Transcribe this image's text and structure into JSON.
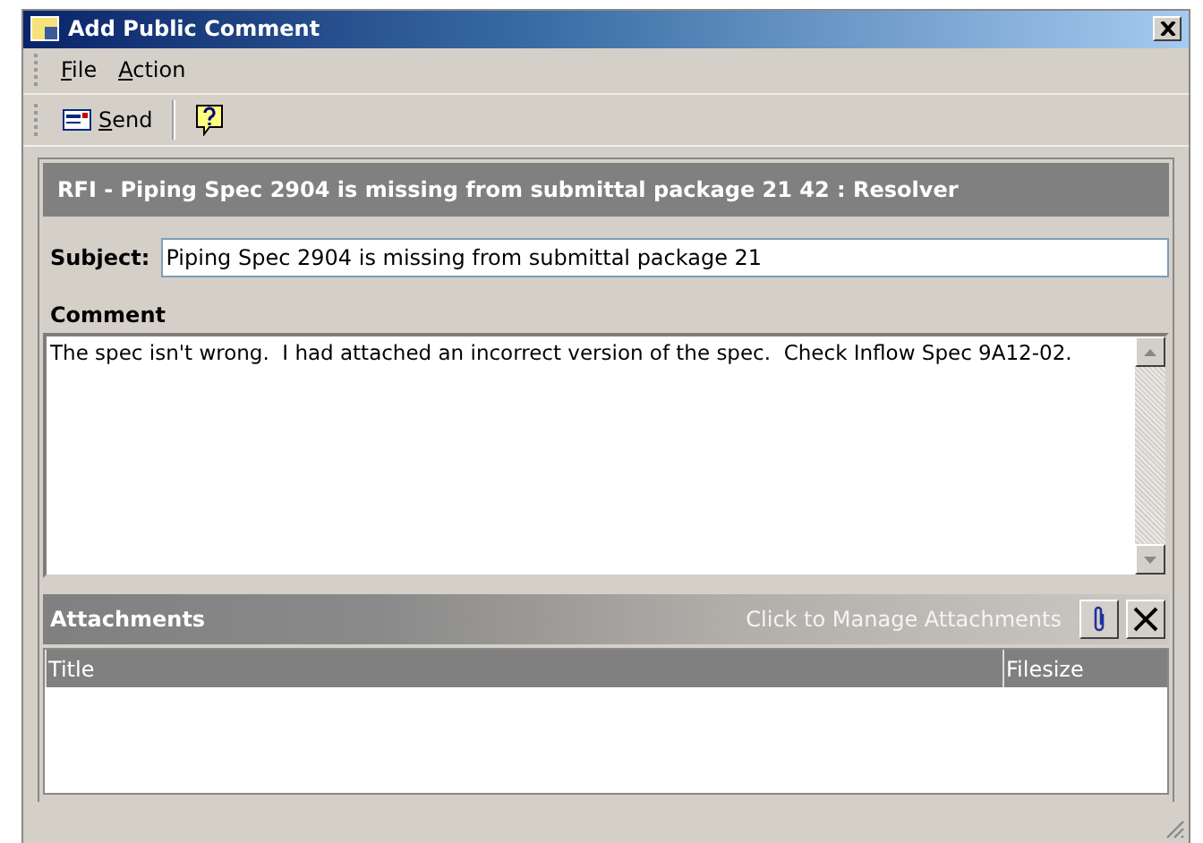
{
  "window": {
    "title": "Add Public Comment"
  },
  "menu": [
    {
      "label": "File"
    },
    {
      "label": "Action"
    }
  ],
  "toolbar": {
    "send": "Send"
  },
  "header": "RFI - Piping Spec 2904 is missing from submittal package 21 42 : Resolver",
  "subject": {
    "label": "Subject:",
    "value": "Piping Spec 2904 is missing from submittal package 21"
  },
  "comment": {
    "label": "Comment",
    "value": "The spec isn't wrong.  I had attached an incorrect version of the spec.  Check Inflow Spec 9A12-02."
  },
  "attachments": {
    "title": "Attachments",
    "hint": "Click to Manage Attachments",
    "columns": [
      "Title",
      "Filesize"
    ]
  }
}
